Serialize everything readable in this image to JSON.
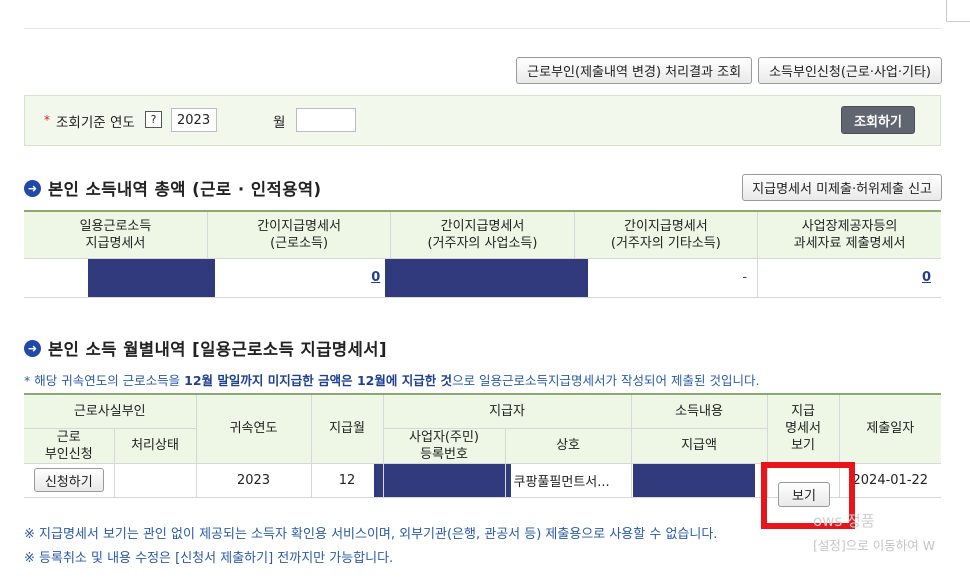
{
  "header": {
    "btn_result": "근로부인(제출내역 변경) 처리결과 조회",
    "btn_request": "소득부인신청(근로·사업·기타)"
  },
  "search": {
    "label": "조회기준 연도",
    "help": "?",
    "year_value": "2023",
    "month_label": "월",
    "month_value": "",
    "query_btn": "조회하기"
  },
  "section1": {
    "title": "본인 소득내역 총액  (근로 · 인적용역)",
    "report_btn": "지급명세서 미제출·허위제출 신고",
    "headers": [
      [
        "일용근로소득",
        "지급명세서"
      ],
      [
        "간이지급명세서",
        "(근로소득)"
      ],
      [
        "간이지급명세서",
        "(거주자의 사업소득)"
      ],
      [
        "간이지급명세서",
        "(거주자의 기타소득)"
      ],
      [
        "사업장제공자등의",
        "과세자료 제출명세서"
      ]
    ],
    "values": [
      "",
      "0",
      "",
      "-",
      "0"
    ]
  },
  "section2": {
    "title": "본인 소득 월별내역 [일용근로소득 지급명세서]",
    "note_pre": "* 해당 귀속연도의 근로소득을 ",
    "note_b1": "12월 말일까지 미지급한 금액은 12월에 지급한 것",
    "note_post": "으로 일용근로소득지급명세서가 작성되어 제출된 것입니다.",
    "h_group1": "근로사실부인",
    "h_group1_a": "근로",
    "h_group1_a2": "부인신청",
    "h_group1_b": "처리상태",
    "h_year": "귀속연도",
    "h_month": "지급월",
    "h_payer": "지급자",
    "h_payer_id1": "사업자(주민)",
    "h_payer_id2": "등록번호",
    "h_payer_name": "상호",
    "h_income": "소득내용",
    "h_income_amount": "지급액",
    "h_view1": "지급",
    "h_view2": "명세서",
    "h_view3": "보기",
    "h_date": "제출일자",
    "row": {
      "apply_btn": "신청하기",
      "status": "",
      "year": "2023",
      "month": "12",
      "name": "쿠팡풀필먼트서...",
      "view_btn": "보기",
      "date": "2024-01-22"
    }
  },
  "footnotes": [
    "※ 지급명세서 보기는 관인 없이 제공되는 소득자 확인용 서비스이며, 외부기관(은행, 관공서 등) 제출용으로 사용할 수 없습니다.",
    "※ 등록취소 및 내용 수정은 [신청서 제출하기] 전까지만 가능합니다."
  ],
  "watermark": {
    "line1": "ows 정품",
    "line2": "[설정]으로 이동하여 W"
  }
}
